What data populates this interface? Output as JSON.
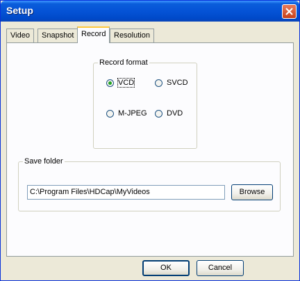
{
  "window": {
    "title": "Setup"
  },
  "tabs": [
    {
      "label": "Video"
    },
    {
      "label": "Snapshot"
    },
    {
      "label": "Record",
      "active": true
    },
    {
      "label": "Resolution"
    }
  ],
  "record_format": {
    "label": "Record format",
    "options": [
      {
        "label": "VCD",
        "selected": true
      },
      {
        "label": "SVCD",
        "selected": false
      },
      {
        "label": "M-JPEG",
        "selected": false
      },
      {
        "label": "DVD",
        "selected": false
      }
    ]
  },
  "save_folder": {
    "label": "Save folder",
    "path": "C:\\Program Files\\HDCap\\MyVideos",
    "browse_label": "Browse"
  },
  "footer": {
    "ok_label": "OK",
    "cancel_label": "Cancel"
  },
  "colors": {
    "title_bar": "#0553d6",
    "window_bg": "#ece9d8",
    "tab_highlight": "#ffc83c"
  }
}
